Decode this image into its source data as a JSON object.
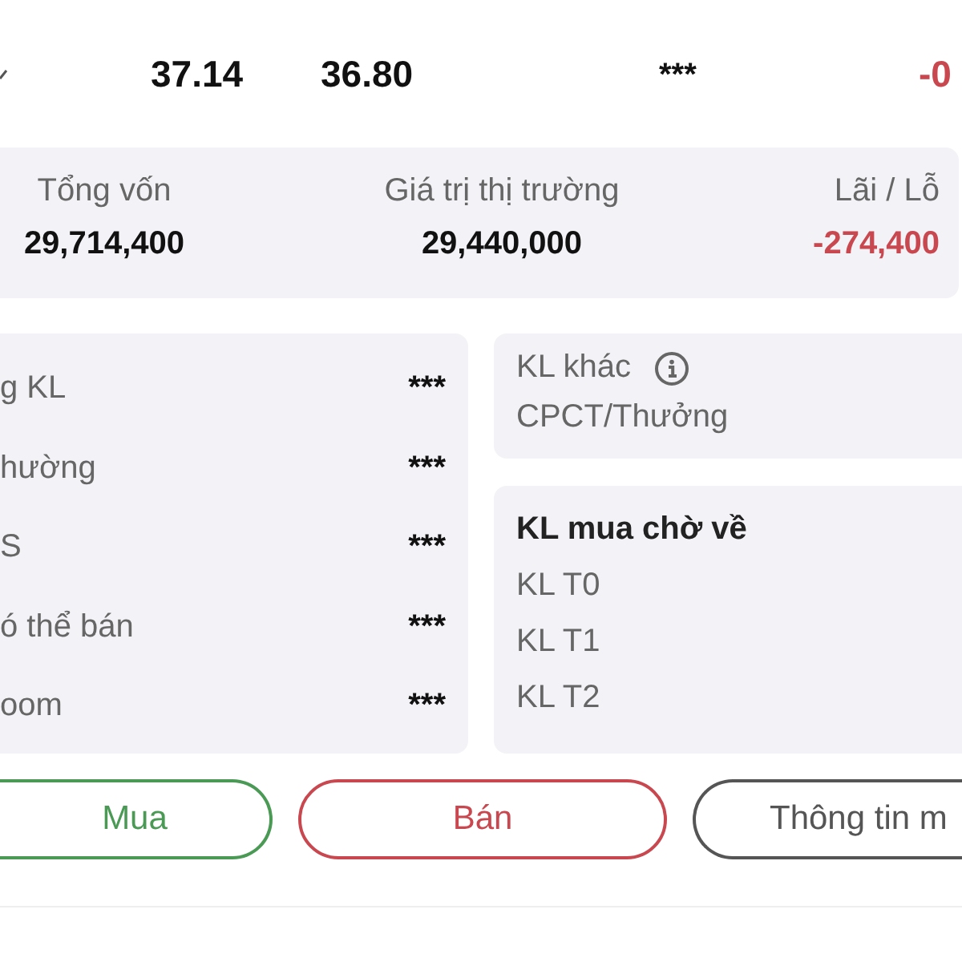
{
  "price_row": {
    "cells": [
      {
        "text": "37.14",
        "negative": false
      },
      {
        "text": "36.80",
        "negative": false
      },
      {
        "text": "***",
        "negative": false
      },
      {
        "text": "-0",
        "negative": true
      }
    ]
  },
  "summary": [
    {
      "label": "Tổng vốn",
      "value": "29,714,400",
      "negative": false
    },
    {
      "label": "Giá trị thị trường",
      "value": "29,440,000",
      "negative": false
    },
    {
      "label": "Lãi / Lỗ",
      "value": "-274,400",
      "negative": true
    }
  ],
  "holdings": [
    {
      "label": "g KL",
      "value": "***"
    },
    {
      "label": "hường",
      "value": "***"
    },
    {
      "label": "S",
      "value": "***"
    },
    {
      "label": "ó thể bán",
      "value": "***"
    },
    {
      "label": "oom",
      "value": "***"
    }
  ],
  "other": {
    "title": "KL khác",
    "subtitle": "CPCT/Thưởng"
  },
  "pending": {
    "title": "KL mua chờ về",
    "items": [
      "KL T0",
      "KL T1",
      "KL T2"
    ]
  },
  "buttons": [
    {
      "label": "Mua",
      "kind": "buy"
    },
    {
      "label": "Bán",
      "kind": "sell"
    },
    {
      "label": "Thông tin m",
      "kind": "info"
    }
  ]
}
